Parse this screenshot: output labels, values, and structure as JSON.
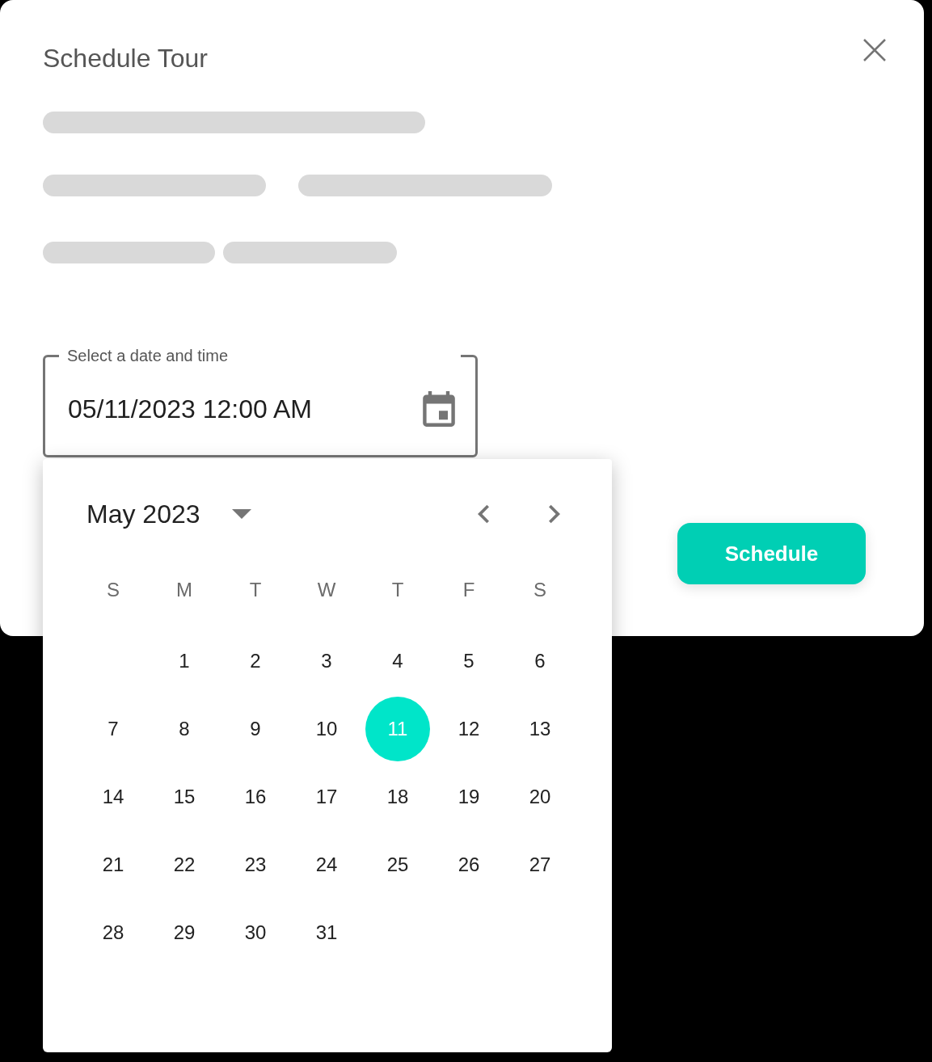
{
  "dialog": {
    "title": "Schedule Tour",
    "details_loading": true
  },
  "date_field": {
    "label": "Select a date and time",
    "value": "05/11/2023 12:00 AM"
  },
  "calendar": {
    "month_label": "May 2023",
    "weekdays": [
      "S",
      "M",
      "T",
      "W",
      "T",
      "F",
      "S"
    ],
    "weeks": [
      {
        "days": [
          {
            "label": "1",
            "selected": false
          },
          {
            "label": "2",
            "selected": false
          },
          {
            "label": "3",
            "selected": false
          },
          {
            "label": "4",
            "selected": false
          },
          {
            "label": "5",
            "selected": false
          },
          {
            "label": "6",
            "selected": false
          }
        ]
      },
      {
        "days": [
          {
            "label": "7",
            "selected": false
          },
          {
            "label": "8",
            "selected": false
          },
          {
            "label": "9",
            "selected": false
          },
          {
            "label": "10",
            "selected": false
          },
          {
            "label": "11",
            "selected": true
          },
          {
            "label": "12",
            "selected": false
          },
          {
            "label": "13",
            "selected": false
          }
        ]
      },
      {
        "days": [
          {
            "label": "14",
            "selected": false
          },
          {
            "label": "15",
            "selected": false
          },
          {
            "label": "16",
            "selected": false
          },
          {
            "label": "17",
            "selected": false
          },
          {
            "label": "18",
            "selected": false
          },
          {
            "label": "19",
            "selected": false
          },
          {
            "label": "20",
            "selected": false
          }
        ]
      },
      {
        "days": [
          {
            "label": "21",
            "selected": false
          },
          {
            "label": "22",
            "selected": false
          },
          {
            "label": "23",
            "selected": false
          },
          {
            "label": "24",
            "selected": false
          },
          {
            "label": "25",
            "selected": false
          },
          {
            "label": "26",
            "selected": false
          },
          {
            "label": "27",
            "selected": false
          }
        ]
      },
      {
        "days": [
          {
            "label": "28",
            "selected": false
          },
          {
            "label": "29",
            "selected": false
          },
          {
            "label": "30",
            "selected": false
          },
          {
            "label": "31",
            "selected": false
          }
        ]
      }
    ]
  },
  "schedule_button": {
    "label": "Schedule"
  }
}
